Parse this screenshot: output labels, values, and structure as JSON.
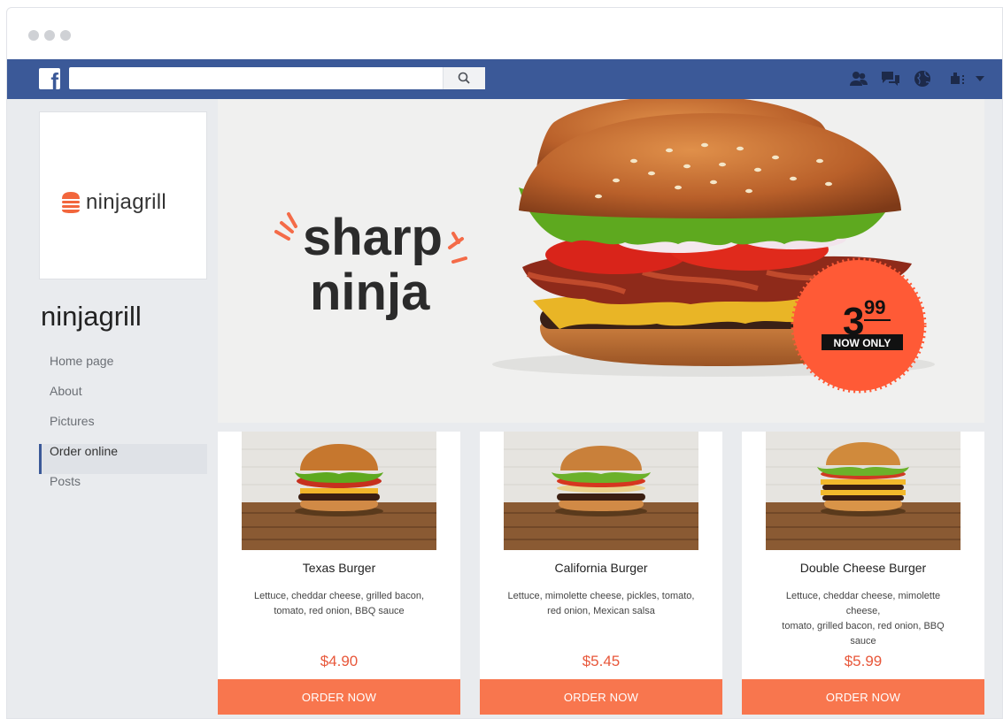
{
  "browser": {
    "window_dots": 3
  },
  "fb_bar": {
    "logo_letter": "f",
    "search": {
      "value": "",
      "placeholder": ""
    },
    "icons": [
      "friends-icon",
      "messages-icon",
      "globe-icon"
    ],
    "account_icon": "account-menu-icon"
  },
  "sidebar": {
    "logo_text": "ninjagrill",
    "page_name": "ninjagrill",
    "nav": [
      {
        "label": "Home page",
        "active": false
      },
      {
        "label": "About",
        "active": false
      },
      {
        "label": "Pictures",
        "active": false
      },
      {
        "label": "Order online",
        "active": true
      },
      {
        "label": "Posts",
        "active": false
      }
    ]
  },
  "cover": {
    "headline_line1": "sharp",
    "headline_line2": "ninja",
    "price_whole": "3",
    "price_cents": "99",
    "price_caption": "NOW ONLY"
  },
  "products": [
    {
      "name": "Texas Burger",
      "desc_line1": "Lettuce, cheddar cheese, grilled bacon,",
      "desc_line2": "tomato, red onion, BBQ sauce",
      "price": "$4.90",
      "button": "ORDER NOW"
    },
    {
      "name": "California Burger",
      "desc_line1": "Lettuce, mimolette cheese, pickles, tomato,",
      "desc_line2": "red onion, Mexican salsa",
      "price": "$5.45",
      "button": "ORDER NOW"
    },
    {
      "name": "Double Cheese Burger",
      "desc_line1": "Lettuce, cheddar cheese, mimolette cheese,",
      "desc_line2": "tomato, grilled bacon, red onion, BBQ sauce",
      "price": "$5.99",
      "button": "ORDER NOW"
    }
  ],
  "colors": {
    "facebook_blue": "#3b5998",
    "accent_orange": "#f8764e",
    "price_red": "#e8573a",
    "page_bg": "#e9ebee"
  }
}
